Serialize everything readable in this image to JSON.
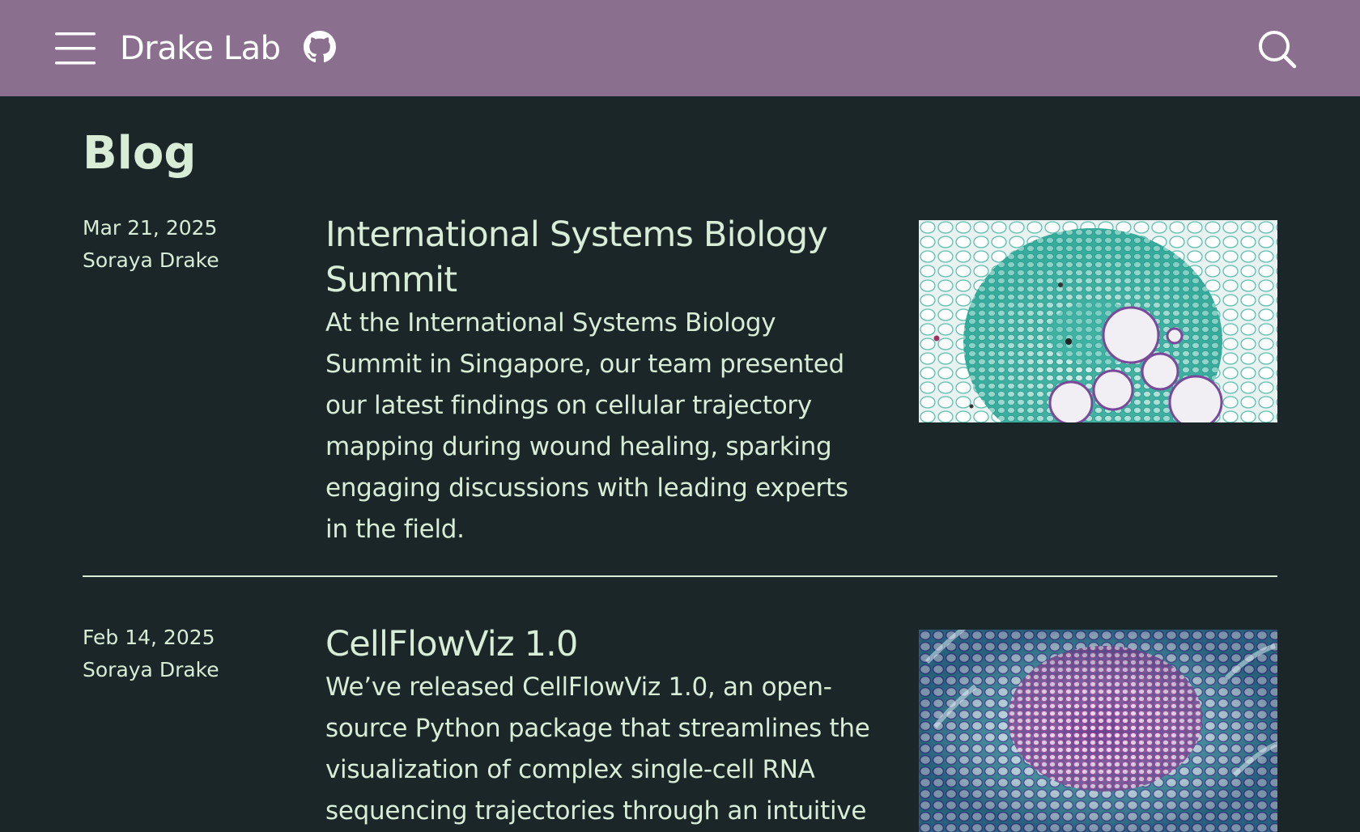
{
  "header": {
    "brand": "Drake Lab",
    "menu_icon": "hamburger-menu-icon",
    "github_icon": "github-icon",
    "search_icon": "search-icon",
    "background_color": "#8b6f8f"
  },
  "page": {
    "title": "Blog",
    "background_color": "#1a2627",
    "text_color": "#d8ecd6"
  },
  "posts": [
    {
      "date": "Mar 21, 2025",
      "author": "Soraya Drake",
      "title": "International Systems Biology Summit",
      "excerpt": "At the International Systems Biology Summit in Singapore, our team presented our latest findings on cellular trajectory mapping during wound healing, sparking engaging discussions with leading experts in the field.",
      "image": "micrograph-tissue-teal"
    },
    {
      "date": "Feb 14, 2025",
      "author": "Soraya Drake",
      "title": "CellFlowViz 1.0",
      "excerpt": "We’ve released CellFlowViz 1.0, an open-source Python package that streamlines the visualization of complex single-cell RNA sequencing trajectories through an intuitive",
      "image": "micrograph-tissue-purple"
    }
  ]
}
